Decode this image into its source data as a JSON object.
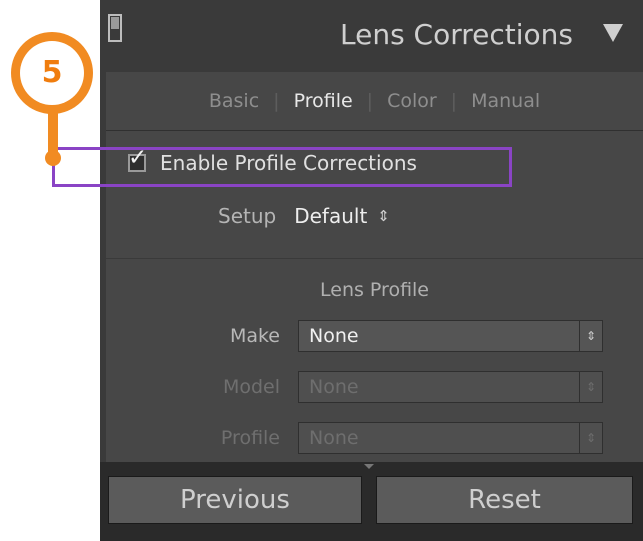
{
  "panel": {
    "title": "Lens Corrections",
    "collapse_icon": "triangle-down-icon",
    "toggle_icon": "panel-switch-icon"
  },
  "tabs": [
    {
      "label": "Basic",
      "active": false
    },
    {
      "label": "Profile",
      "active": true
    },
    {
      "label": "Color",
      "active": false
    },
    {
      "label": "Manual",
      "active": false
    }
  ],
  "enable_profile": {
    "label": "Enable Profile Corrections",
    "checked": true,
    "checkmark": "✓"
  },
  "setup": {
    "label": "Setup",
    "value": "Default",
    "caret": "⇕"
  },
  "lens_profile": {
    "heading": "Lens Profile",
    "fields": [
      {
        "label": "Make",
        "value": "None",
        "enabled": true
      },
      {
        "label": "Model",
        "value": "None",
        "enabled": false
      },
      {
        "label": "Profile",
        "value": "None",
        "enabled": false
      }
    ],
    "spin_glyph": "⇕"
  },
  "buttons": {
    "previous": "Previous",
    "reset": "Reset"
  },
  "annotation": {
    "step_number": "5",
    "colors": {
      "callout": "#f18b22",
      "highlight": "#8a44c5"
    }
  }
}
